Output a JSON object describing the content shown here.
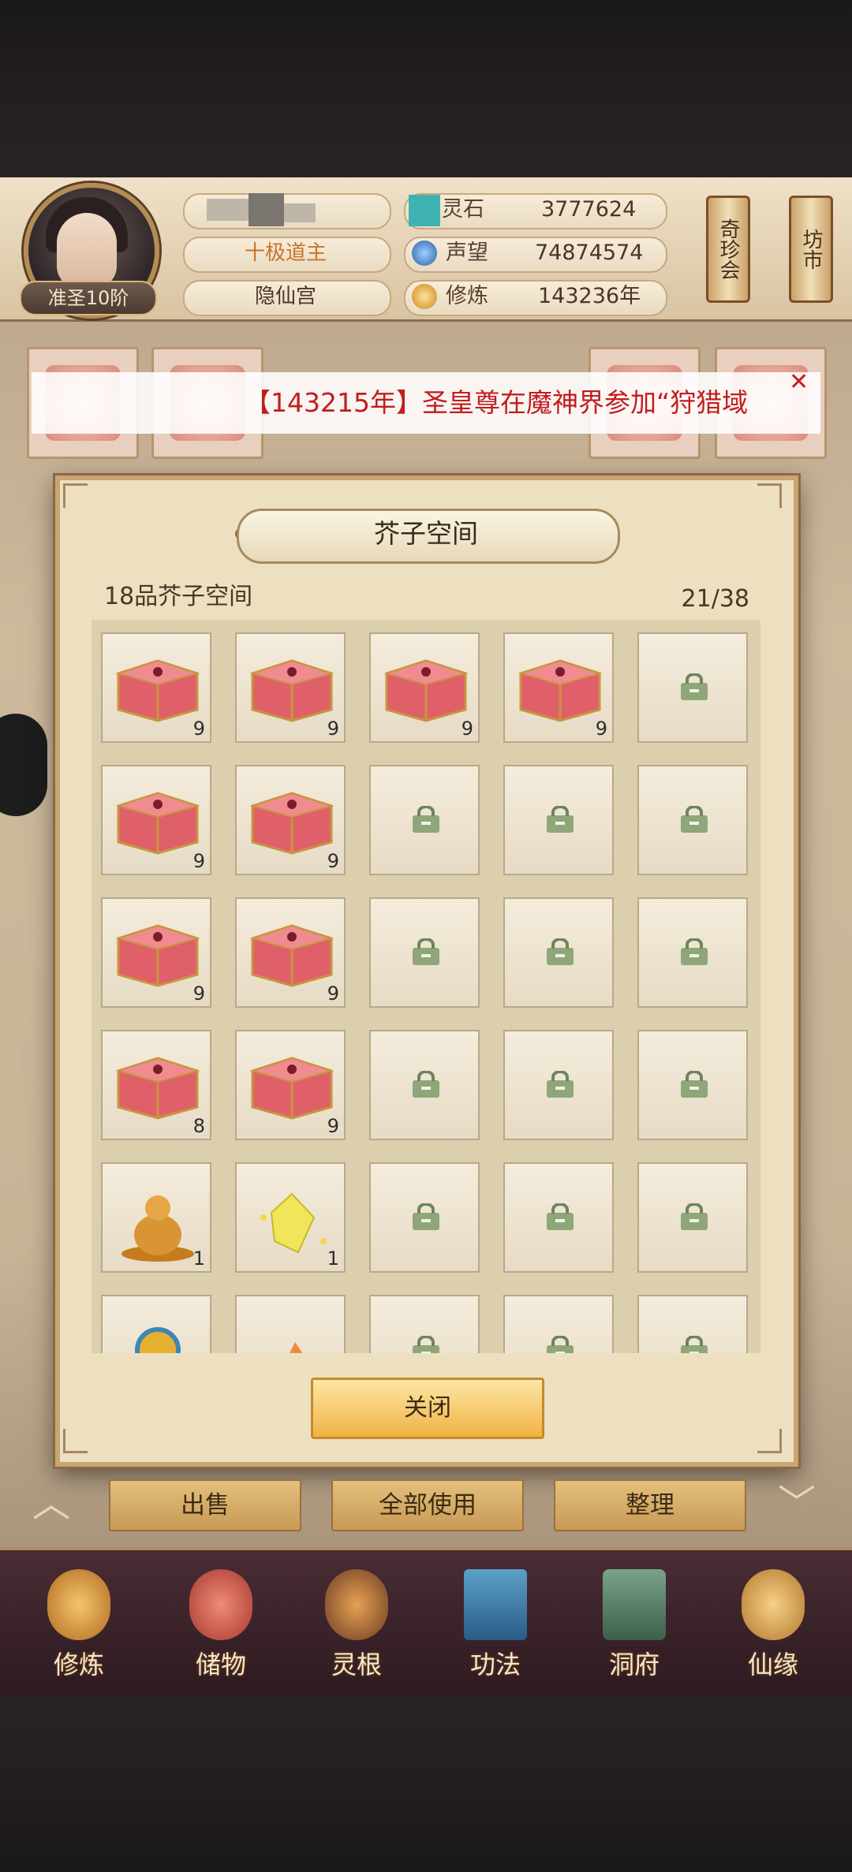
{
  "header": {
    "rank": "准圣10阶",
    "title_badge": "十极道主",
    "sect": "隐仙宫",
    "stats": [
      {
        "label": "灵石",
        "value": "3777624",
        "icon": "spirit-stone-icon"
      },
      {
        "label": "声望",
        "value": "74874574",
        "icon": "reputation-icon"
      },
      {
        "label": "修炼",
        "value": "143236年",
        "icon": "cultivation-icon"
      }
    ],
    "side_buttons": [
      {
        "label": "奇珍会"
      },
      {
        "label": "坊市"
      }
    ]
  },
  "marquee": {
    "text": "【143215年】圣皇尊在魔神界参加“狩猎域"
  },
  "modal": {
    "title": "芥子空间",
    "space_name": "18品芥子空间",
    "capacity": "21/38",
    "close_label": "关闭",
    "slots": [
      {
        "item": "chest-icon",
        "count": "9"
      },
      {
        "item": "chest-icon",
        "count": "9"
      },
      {
        "item": "chest-icon",
        "count": "9"
      },
      {
        "item": "chest-icon",
        "count": "9"
      },
      {
        "item": "lock-icon",
        "count": ""
      },
      {
        "item": "chest-icon",
        "count": "9"
      },
      {
        "item": "chest-icon",
        "count": "9"
      },
      {
        "item": "lock-icon",
        "count": ""
      },
      {
        "item": "lock-icon",
        "count": ""
      },
      {
        "item": "lock-icon",
        "count": ""
      },
      {
        "item": "chest-icon",
        "count": "9"
      },
      {
        "item": "chest-icon",
        "count": "9"
      },
      {
        "item": "lock-icon",
        "count": ""
      },
      {
        "item": "lock-icon",
        "count": ""
      },
      {
        "item": "lock-icon",
        "count": ""
      },
      {
        "item": "chest-icon",
        "count": "8"
      },
      {
        "item": "chest-icon",
        "count": "9"
      },
      {
        "item": "lock-icon",
        "count": ""
      },
      {
        "item": "lock-icon",
        "count": ""
      },
      {
        "item": "lock-icon",
        "count": ""
      },
      {
        "item": "golden-buddha-icon",
        "count": "1"
      },
      {
        "item": "yellow-crystal-icon",
        "count": "1"
      },
      {
        "item": "lock-icon",
        "count": ""
      },
      {
        "item": "lock-icon",
        "count": ""
      },
      {
        "item": "lock-icon",
        "count": ""
      },
      {
        "item": "orb-icon",
        "count": ""
      },
      {
        "item": "orange-crystal-icon",
        "count": ""
      },
      {
        "item": "lock-icon",
        "count": ""
      },
      {
        "item": "lock-icon",
        "count": ""
      },
      {
        "item": "lock-icon",
        "count": ""
      }
    ]
  },
  "actions": {
    "sell": "出售",
    "use_all": "全部使用",
    "organize": "整理"
  },
  "nav": [
    {
      "label": "修炼",
      "icon": "cultivate-icon"
    },
    {
      "label": "储物",
      "icon": "storage-bag-icon"
    },
    {
      "label": "灵根",
      "icon": "spirit-root-icon"
    },
    {
      "label": "功法",
      "icon": "technique-book-icon"
    },
    {
      "label": "洞府",
      "icon": "cave-house-icon"
    },
    {
      "label": "仙缘",
      "icon": "fate-icon"
    }
  ],
  "colors": {
    "chest": "#e0606a",
    "lock": "#8fa679",
    "marquee_text": "#c21d1d",
    "close_button": "#f0b344"
  }
}
